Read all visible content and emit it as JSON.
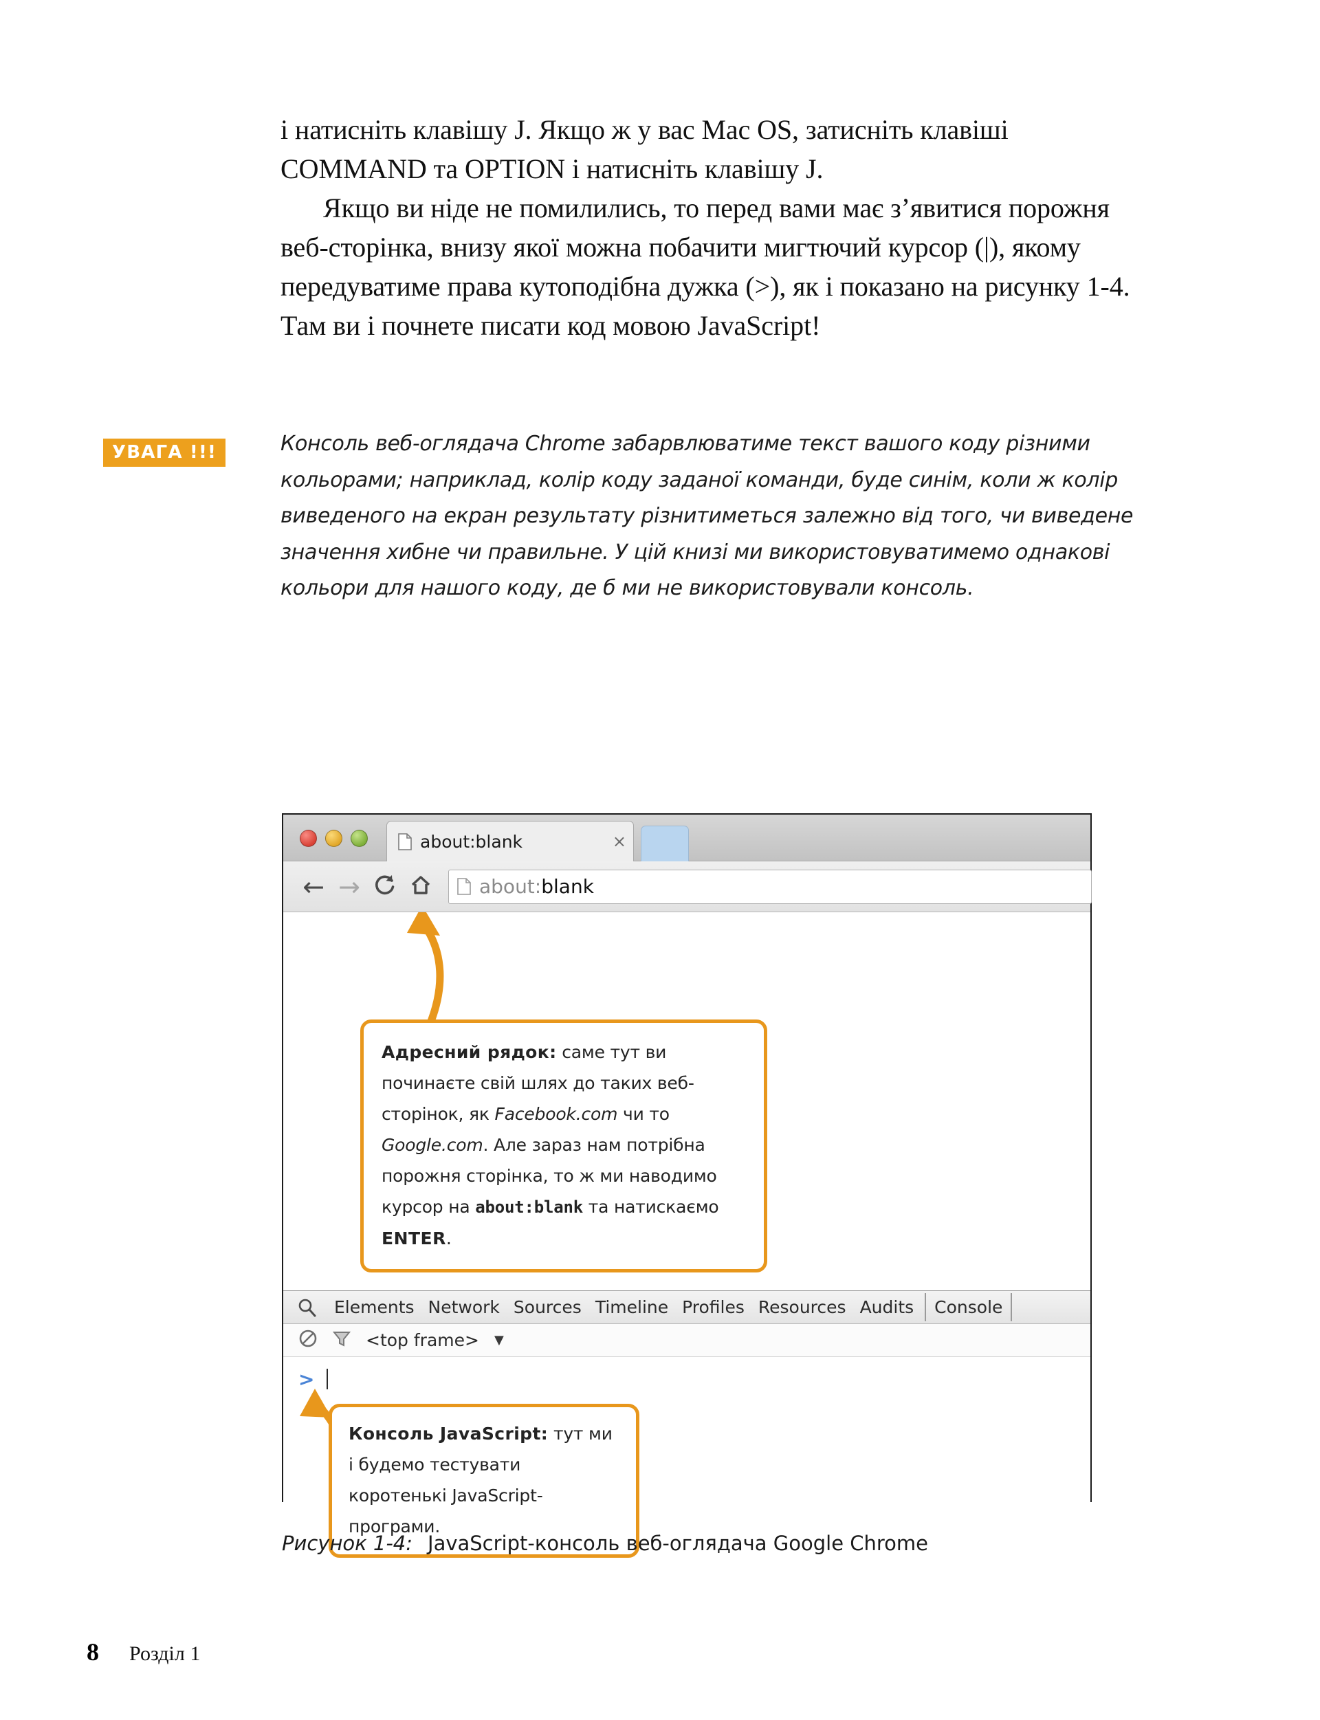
{
  "body": {
    "paragraphs": [
      "і натисніть клавішу J. Якщо ж у вас Mac OS, затисніть клавіші COMMAND та OPTION і натисніть клавішу J.",
      "Якщо ви ніде не помилились, то перед вами має з’явитися порожня веб-сторінка, внизу якої можна побачити мигтючий курсор (|), якому передуватиме права кутоподібна дужка (>), як і показано на рисунку 1-4. Там ви і почнете писати код мовою JavaScript!"
    ]
  },
  "warning": {
    "badge": "УВАГА !!!",
    "text": "Консоль веб-оглядача Chrome забарвлюватиме текст вашого коду різними кольорами; наприклад, колір коду заданої команди, буде синім, коли ж колір виведеного на екран результату різнитиметься залежно від того, чи виведене значення хибне чи правильне. У цій книзі ми використовуватимемо однакові кольори для нашого коду, де б ми не використовували консоль.",
    "badge_bg": "#eda01d",
    "badge_color": "#ffffff"
  },
  "figure": {
    "browser": {
      "window_controls": [
        "close",
        "minimize",
        "zoom"
      ],
      "tab": {
        "title": "about:blank",
        "close_label": "×",
        "icon": "page-icon"
      },
      "toolbar": {
        "back": "←",
        "forward": "→",
        "reload": "C",
        "home": "⌂",
        "omnibox_icon": "page-icon",
        "url_prefix": "about:",
        "url_suffix": "blank"
      }
    },
    "callout_address": {
      "lead": "Адресний рядок:",
      "part1": " саме тут ви починаєте свій шлях до таких веб-сторінок, як ",
      "em1": "Facebook.com",
      "part2": " чи то ",
      "em2": "Google.com",
      "part3": ". Але зараз нам потрібна порожня сторінка, то ж ми наводимо курсор на ",
      "mono": "about:blank",
      "part4": " та натискаємо ",
      "kbd": "ENTER",
      "part5": "."
    },
    "callout_console": {
      "lead": "Консоль JavaScript:",
      "part1": " тут ми і будемо тестувати коротенькі JavaScript-програми."
    },
    "devtools": {
      "search_icon": "search-icon",
      "tabs": [
        "Elements",
        "Network",
        "Sources",
        "Timeline",
        "Profiles",
        "Resources",
        "Audits"
      ],
      "active_tab": "Console",
      "filter_bar": {
        "clear_icon": "no-entry-icon",
        "filter_icon": "funnel-icon",
        "frame_label": "<top frame>",
        "caret": "▼"
      },
      "console_prompt": ">"
    },
    "accent_color": "#e8971c"
  },
  "caption": {
    "number": "Рисунок 1-4:",
    "text": "JavaScript-консоль веб-оглядача Google Chrome"
  },
  "footer": {
    "page_number": "8",
    "chapter": "Розділ 1"
  }
}
